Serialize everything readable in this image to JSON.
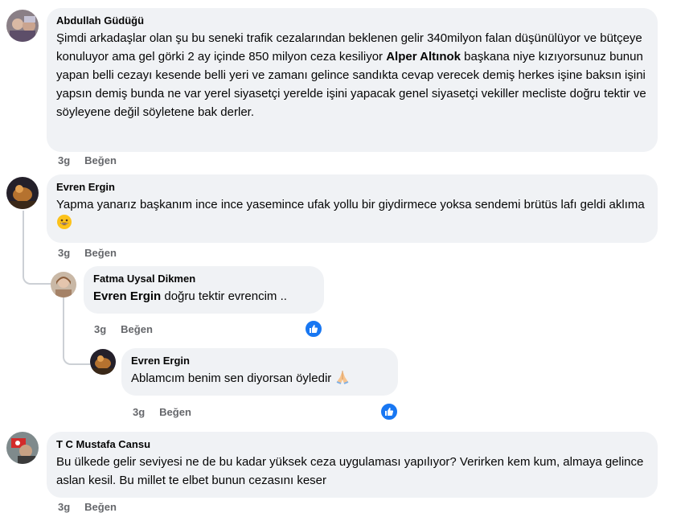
{
  "comments": [
    {
      "author": "Abdullah Güdüğü",
      "text_before": "Şimdi arkadaşlar olan şu bu seneki trafik cezalarından beklenen gelir 340milyon falan düşünülüyor ve bütçeye konuluyor ama gel görki 2 ay içinde 850 milyon ceza kesiliyor ",
      "mention": "Alper Altınok",
      "text_after": " başkana niye kızıyorsunuz bunun yapan belli cezayı kesende belli yeri ve zamanı gelince sandıkta cevap verecek demiş herkes işine baksın işini yapsın demiş bunda ne var yerel siyasetçi yerelde işini yapacak genel siyasetçi vekiller mecliste doğru tektir ve söyleyene değil söyletene bak derler.",
      "time": "3g",
      "like_label": "Beğen"
    },
    {
      "author": "Evren Ergin",
      "text": "Yapma yanarız başkanım ince ince yasemince ufak yollu bir giydirmece yoksa sendemi brütüs lafı geldi aklıma",
      "emoji": "grinning-face-emoji",
      "time": "3g",
      "like_label": "Beğen"
    },
    {
      "author": "Fatma Uysal Dikmen",
      "mention": "Evren Ergin",
      "text": " doğru tektir evrencim ..",
      "time": "3g",
      "like_label": "Beğen",
      "reaction": "like-reaction-icon"
    },
    {
      "author": "Evren Ergin",
      "text": "Ablamcım benim sen diyorsan öyledir",
      "emoji": "folded-hands-emoji",
      "time": "3g",
      "like_label": "Beğen",
      "reaction": "like-reaction-icon"
    },
    {
      "author": "T C Mustafa Cansu",
      "text": "Bu ülkede gelir seviyesi ne de bu kadar yüksek ceza uygulaması yapılıyor? Verirken kem kum, almaya gelince aslan kesil. Bu millet te elbet bunun cezasını keser",
      "time": "3g",
      "like_label": "Beğen"
    }
  ],
  "colors": {
    "bubble": "#f0f2f5",
    "meta": "#65676b",
    "like_blue": "#1877f2",
    "thread_line": "#ccd0d5"
  }
}
